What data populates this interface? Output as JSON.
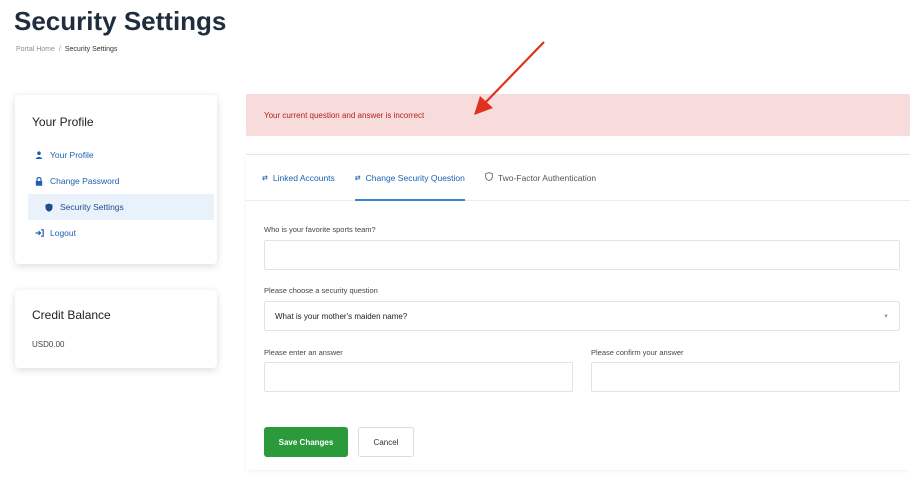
{
  "page": {
    "title": "Security Settings"
  },
  "breadcrumb": {
    "home": "Portal Home",
    "separator": "/",
    "current": "Security Settings"
  },
  "sidebar": {
    "profile_title": "Your Profile",
    "items": [
      {
        "label": "Your Profile",
        "icon": "user-icon"
      },
      {
        "label": "Change Password",
        "icon": "lock-icon"
      },
      {
        "label": "Security Settings",
        "icon": "shield-icon",
        "active": true
      },
      {
        "label": "Logout",
        "icon": "logout-icon"
      }
    ],
    "credit_title": "Credit Balance",
    "credit_value": "USD0.00"
  },
  "alert": {
    "message": "Your current question and answer is incorrect",
    "color": "#b32121"
  },
  "tabs": [
    {
      "label": "Linked Accounts",
      "icon": "link-icon"
    },
    {
      "label": "Change Security Question",
      "icon": "link-icon",
      "active": true
    },
    {
      "label": "Two-Factor Authentication",
      "icon": "shield-outline-icon"
    }
  ],
  "form": {
    "current_question_label": "Who is your favorite sports team?",
    "current_answer_value": "",
    "new_question_label": "Please choose a security question",
    "new_question_selected": "What is your mother's maiden name?",
    "answer_label": "Please enter an answer",
    "answer_value": "",
    "confirm_label": "Please confirm your answer",
    "confirm_value": ""
  },
  "buttons": {
    "save": "Save Changes",
    "cancel": "Cancel"
  },
  "colors": {
    "primary": "#2a9a3a",
    "link": "#1e5fb4",
    "alert_bg": "#f8dcdc",
    "annotation_arrow": "#e0301e"
  }
}
